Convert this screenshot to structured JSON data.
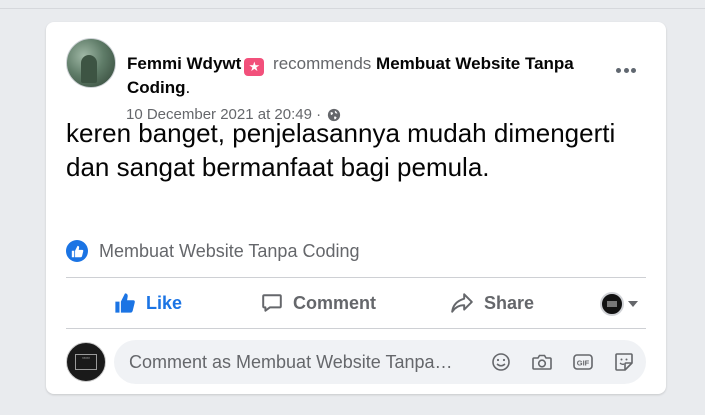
{
  "post": {
    "author": "Femmi Wdywt",
    "author_badge_icon": "star-badge-icon",
    "verb": "recommends",
    "page_name": "Membuat Website Tanpa Coding",
    "page_name_suffix": ".",
    "timestamp": "10 December 2021 at 20:49",
    "meta_separator": "·",
    "privacy_icon": "globe-icon",
    "body": "keren banget, penjelasannya mudah dimengerti dan sangat bermanfaat bagi pemula.",
    "recommended_page_label": "Membuat Website Tanpa Coding"
  },
  "actions": {
    "like": "Like",
    "comment": "Comment",
    "share": "Share"
  },
  "comment_box": {
    "placeholder": "Comment as Membuat Website Tanpa…",
    "icons": [
      "emoji-icon",
      "camera-icon",
      "gif-icon",
      "sticker-icon"
    ]
  },
  "colors": {
    "accent_blue": "#1b74e4",
    "badge_pink": "#f2507b",
    "secondary_text": "#65676b",
    "background": "#e9ebee"
  }
}
